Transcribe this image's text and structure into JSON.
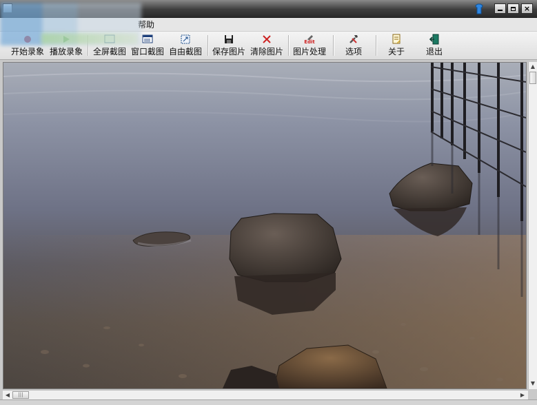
{
  "window": {
    "title": "",
    "controls": {
      "minimize": "minimize",
      "maximize": "maximize",
      "close": "×"
    }
  },
  "menubar": {
    "items": [
      {
        "label": "帮助"
      }
    ]
  },
  "toolbar": {
    "buttons": [
      {
        "label": "开始录象",
        "icon": "record-icon"
      },
      {
        "label": "播放录象",
        "icon": "play-icon"
      },
      {
        "label": "全屏截图",
        "icon": "fullscreen-capture-icon"
      },
      {
        "label": "窗口截图",
        "icon": "window-capture-icon"
      },
      {
        "label": "自由截图",
        "icon": "free-capture-icon"
      },
      {
        "label": "保存图片",
        "icon": "save-icon"
      },
      {
        "label": "清除图片",
        "icon": "clear-icon"
      },
      {
        "label": "图片处理",
        "icon": "edit-icon",
        "icon_text": "Edit"
      },
      {
        "label": "选项",
        "icon": "tools-icon"
      },
      {
        "label": "关于",
        "icon": "about-icon"
      },
      {
        "label": "退出",
        "icon": "exit-icon"
      }
    ]
  },
  "colors": {
    "titlebar": "#3e3e3e",
    "toolbar": "#e8e8e8",
    "clear_icon": "#cc2222",
    "edit_icon": "#cc2222"
  },
  "canvas": {
    "content": "captured photo"
  }
}
